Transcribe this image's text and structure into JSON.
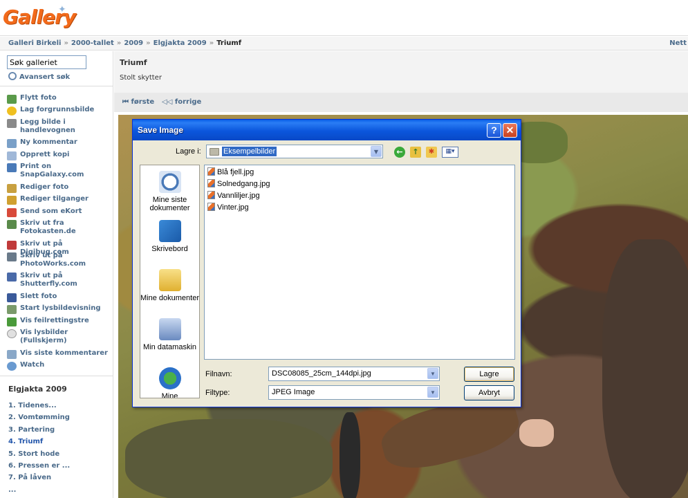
{
  "header": {
    "logo_text": "Gallery"
  },
  "breadcrumb": {
    "items": [
      "Galleri Birkeli",
      "2000-tallet",
      "2009",
      "Elgjakta 2009"
    ],
    "current": "Triumf",
    "right_text": "Nett"
  },
  "sidebar": {
    "search_value": "Søk galleriet",
    "advanced_search": "Avansert søk",
    "actions": [
      "Flytt foto",
      "Lag forgrunnsbilde",
      "Legg bilde i handlevognen",
      "Ny kommentar",
      "Opprett kopi",
      "Print on SnapGalaxy.com",
      "Rediger foto",
      "Rediger tilganger",
      "Send som eKort",
      "Skriv ut fra Fotokasten.de",
      "Skriv ut på Digibug.com",
      "Skriv ut på PhotoWorks.com",
      "Skriv ut på Shutterfly.com",
      "Slett foto",
      "Start lysbildevisning",
      "Vis feilrettingstre",
      "Vis lysbilder (Fullskjerm)",
      "Vis siste kommentarer",
      "Watch"
    ],
    "album_title": "Elgjakta 2009",
    "album_items": [
      "1. Tidenes...",
      "2. Vomtømming",
      "3. Partering",
      "4. Triumf",
      "5. Stort hode",
      "6. Pressen er ...",
      "7. På låven",
      "..."
    ]
  },
  "main": {
    "title": "Triumf",
    "description": "Stolt skytter",
    "nav": {
      "first": "første",
      "prev": "forrige"
    }
  },
  "dialog": {
    "title": "Save Image",
    "help_glyph": "?",
    "close_glyph": "✕",
    "lagre_i_label": "Lagre i:",
    "location": "Eksempelbilder",
    "places": [
      "Mine siste dokumenter",
      "Skrivebord",
      "Mine dokumenter",
      "Min datamaskin",
      "Mine"
    ],
    "files": [
      "Blå fjell.jpg",
      "Solnedgang.jpg",
      "Vannliljer.jpg",
      "Vinter.jpg"
    ],
    "filename_label": "Filnavn:",
    "filename_value": "DSC08085_25cm_144dpi.jpg",
    "filetype_label": "Filtype:",
    "filetype_value": "JPEG Image",
    "save_label": "Lagre",
    "cancel_label": "Avbryt"
  },
  "colors": {
    "link": "#4a6a8a",
    "titlebar": "#0b56dc",
    "logo": "#f26a1b"
  }
}
